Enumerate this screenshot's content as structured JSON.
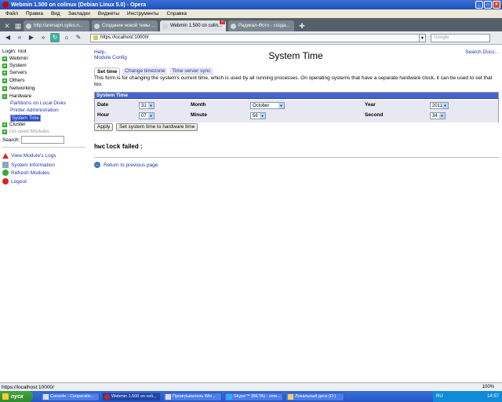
{
  "window": {
    "title": "Webmin 1.500 on colinux (Debian Linux 5.0) - Opera"
  },
  "menu": [
    "Файл",
    "Правка",
    "Вид",
    "Закладки",
    "Виджеты",
    "Инструменты",
    "Справка"
  ],
  "tabs": [
    {
      "label": "http://arenapri.sytes.n..."
    },
    {
      "label": "Создание новой темы ..."
    },
    {
      "label": "Webmin 1.500 on colin..."
    },
    {
      "label": "Радикал-Фото - созда..."
    }
  ],
  "address": {
    "url": "https://localhost:10000/",
    "search_placeholder": "Google"
  },
  "sidebar": {
    "login": "Login: root",
    "categories": [
      "Webmin",
      "System",
      "Servers",
      "Others",
      "Networking",
      "Hardware"
    ],
    "hardware_items": [
      "Partitions on Local Disks",
      "Printer Administration",
      "System Time"
    ],
    "cluster": "Cluster",
    "unused": "Un-used Modules",
    "search_label": "Search:",
    "actions": [
      "View Module's Logs",
      "System Information",
      "Refresh Modules",
      "Logout"
    ]
  },
  "main": {
    "help": "Help..",
    "module_config": "Module Config",
    "title": "System Time",
    "search_docs": "Search Docs..",
    "tabs": [
      "Set time",
      "Change timezone",
      "Time server sync"
    ],
    "description": "This form is for changing the system's current time, which is used by all running processes. On operating systems that have a separate hardware clock, it can be used to set that too.",
    "table_header": "System Time",
    "fields": {
      "date_label": "Date",
      "date_value": "31",
      "month_label": "Month",
      "month_value": "October",
      "year_label": "Year",
      "year_value": "2011",
      "hour_label": "Hour",
      "hour_value": "07",
      "minute_label": "Minute",
      "minute_value": "56",
      "second_label": "Second",
      "second_value": "34"
    },
    "apply_button": "Apply",
    "hwclock_button": "Set system time to hardware time",
    "fail_cmd": "hwclock",
    "fail_text": " failed :",
    "return_link": "Return to previous page"
  },
  "status": {
    "url": "https://localhost:10000/",
    "zoom": "100%"
  },
  "taskbar": {
    "start": "пуск",
    "items": [
      "Console - Cooperativ...",
      "Webmin 1.500 on coli...",
      "Проигрыватель Win...",
      "Skype™ (BETA) - zme...",
      "Локальный диск (D:)"
    ],
    "lang": "RU",
    "time": "14:57"
  }
}
